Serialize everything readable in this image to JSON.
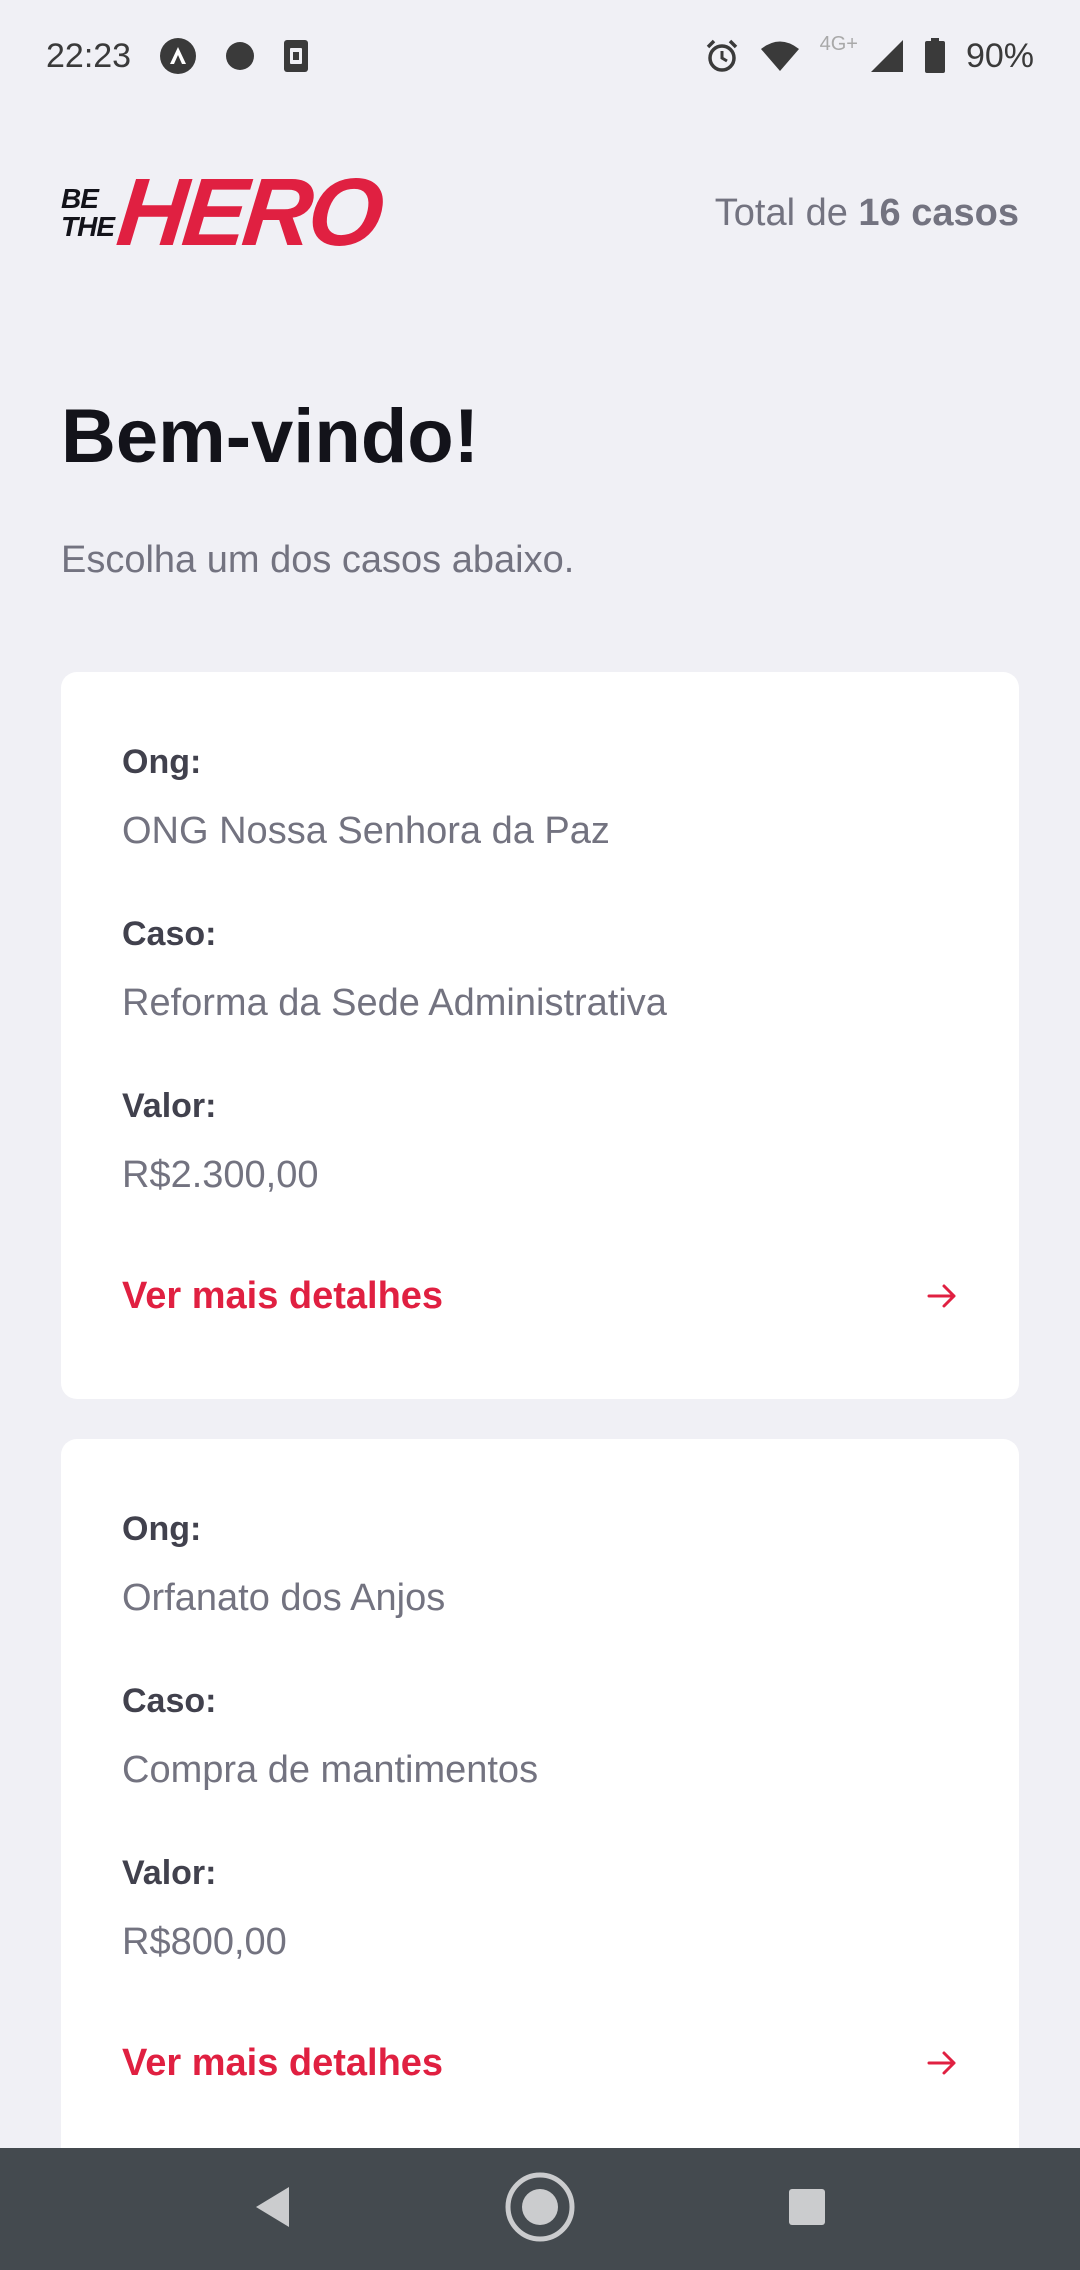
{
  "status_bar": {
    "time": "22:23",
    "network": "4G+",
    "battery": "90%",
    "icons": [
      "app-notification-icon",
      "dot-notification-icon",
      "sim-card-icon",
      "alarm-icon",
      "wifi-icon",
      "signal-icon",
      "battery-icon"
    ]
  },
  "header": {
    "logo_small_line1": "BE",
    "logo_small_line2": "THE",
    "logo_big": "HERO",
    "total_prefix": "Total de ",
    "total_count": "16 casos"
  },
  "welcome": {
    "title": "Bem-vindo!",
    "subtitle": "Escolha um dos casos abaixo."
  },
  "incidents": [
    {
      "ong_label": "Ong:",
      "ong_value": "ONG Nossa Senhora da Paz",
      "case_label": "Caso:",
      "case_value": "Reforma da Sede Administrativa",
      "value_label": "Valor:",
      "value_value": "R$2.300,00",
      "details_label": "Ver mais detalhes"
    },
    {
      "ong_label": "Ong:",
      "ong_value": "Orfanato dos Anjos",
      "case_label": "Caso:",
      "case_value": "Compra de mantimentos",
      "value_label": "Valor:",
      "value_value": "R$800,00",
      "details_label": "Ver mais detalhes"
    }
  ],
  "colors": {
    "brand_red": "#e02041",
    "background": "#f0f0f5",
    "card": "#ffffff",
    "navbar": "#444a4f"
  },
  "nav_bar": {
    "icons": [
      "back-icon",
      "home-icon",
      "recents-icon"
    ]
  }
}
